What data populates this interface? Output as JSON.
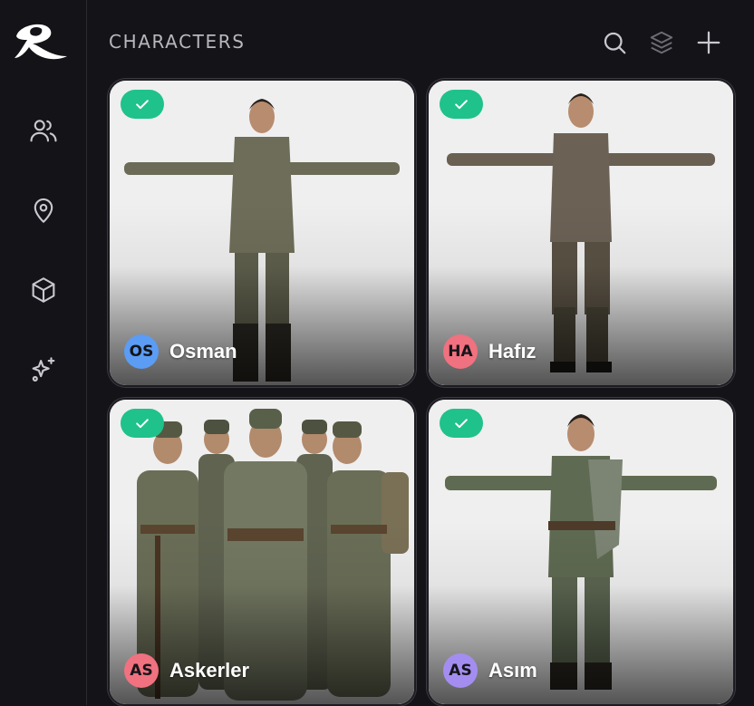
{
  "header": {
    "title": "CHARACTERS"
  },
  "sidebar": {
    "items": [
      {
        "icon": "users-icon"
      },
      {
        "icon": "location-pin-icon"
      },
      {
        "icon": "cube-icon"
      },
      {
        "icon": "sparkles-icon"
      }
    ]
  },
  "toolbar": {
    "icons": [
      "search-icon",
      "layers-icon",
      "plus-icon"
    ]
  },
  "characters": [
    {
      "initials": "OS",
      "name": "Osman",
      "avatar_color": "#5b9cf5",
      "selected": true
    },
    {
      "initials": "HA",
      "name": "Hafız",
      "avatar_color": "#f0717f",
      "selected": true
    },
    {
      "initials": "AS",
      "name": "Askerler",
      "avatar_color": "#f0717f",
      "selected": true
    },
    {
      "initials": "AS",
      "name": "Asım",
      "avatar_color": "#a48df0",
      "selected": true
    }
  ],
  "colors": {
    "accent_check": "#1fc28a",
    "background": "#141317"
  }
}
